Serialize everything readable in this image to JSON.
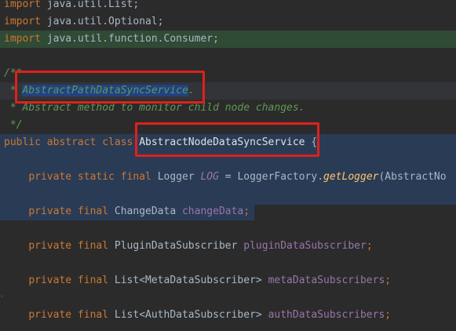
{
  "theme": {
    "background": "#2b2b2b",
    "keyword": "#cc7832",
    "plain": "#a9b7c6",
    "comment": "#629755",
    "field": "#9876aa",
    "method": "#ffc66d",
    "annotation_box": "#e0201c"
  },
  "code": {
    "l1": {
      "kw": "import",
      "rest": " java.util.List;"
    },
    "l2": {
      "kw": "import",
      "rest": " java.util.Optional;"
    },
    "l3": {
      "kw": "import",
      "rest": " java.util.function.Consumer;"
    },
    "l5": {
      "text": "/**"
    },
    "l6": {
      "star": " * ",
      "name": "AbstractPathDataSyncService",
      "tail": "."
    },
    "l7": {
      "text": " * Abstract method to monitor child node changes."
    },
    "l8": {
      "text": " */"
    },
    "l9": {
      "kw": "public abstract class ",
      "name": "AbstractNodeDataSyncService",
      "brace": " {"
    },
    "l11": {
      "kw": "private static final ",
      "type": "Logger ",
      "field": "LOG",
      "eq": " = LoggerFactory.",
      "method": "getLogger",
      "rest": "(AbstractNo"
    },
    "l13": {
      "kw": "private final ",
      "type": "ChangeData ",
      "field": "changeData",
      "semi": ";"
    },
    "l15": {
      "kw": "private final ",
      "type": "PluginDataSubscriber ",
      "field": "pluginDataSubscriber",
      "semi": ";"
    },
    "l17": {
      "kw": "private final ",
      "type": "List<MetaDataSubscriber> ",
      "field": "metaDataSubscribers",
      "semi": ";"
    },
    "l19": {
      "kw": "private final ",
      "type": "List<AuthDataSubscriber> ",
      "field": "authDataSubscribers",
      "semi": ";"
    }
  }
}
